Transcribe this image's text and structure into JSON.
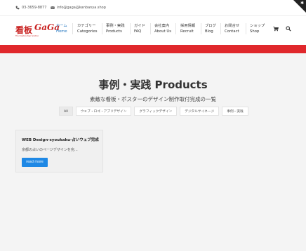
{
  "topbar": {
    "phone": "03-3659-8877",
    "email": "info@gaga@kanbanya.shop"
  },
  "logo": {
    "kanji": "看板",
    "name": "GaGa",
    "tagline": "The Creative Sign Solution"
  },
  "nav": {
    "items": [
      {
        "ja": "ホーム",
        "en": "Home"
      },
      {
        "ja": "カテゴリー",
        "en": "Categories"
      },
      {
        "ja": "事例・実践",
        "en": "Products"
      },
      {
        "ja": "ガイド",
        "en": "FAQ"
      },
      {
        "ja": "会社案内",
        "en": "About Us"
      },
      {
        "ja": "採用情報",
        "en": "Recruit"
      },
      {
        "ja": "ブログ",
        "en": "Blog"
      },
      {
        "ja": "お問合せ",
        "en": "Contact"
      },
      {
        "ja": "ショップ",
        "en": "Shop"
      }
    ],
    "cart_icon": "cart-icon",
    "search_icon": "search-icon"
  },
  "page": {
    "title": "事例・実践 Products",
    "subtitle": "素敵な看板・ポスターのデザイン制作取付完成の一覧"
  },
  "filters": [
    "All",
    "ウェブ・ロゴ・アプリデザイン",
    "グラフィックデザイン",
    "デジタルサイネージ",
    "事例・実践"
  ],
  "card": {
    "title": "WEB Design-syoukaku-占いウェブ完成",
    "excerpt": "京都の占いのページデザインを完...",
    "button": "read more"
  },
  "colors": {
    "accent": "#1e73be",
    "brand_red": "#e0282c",
    "button": "#1e88e5"
  }
}
